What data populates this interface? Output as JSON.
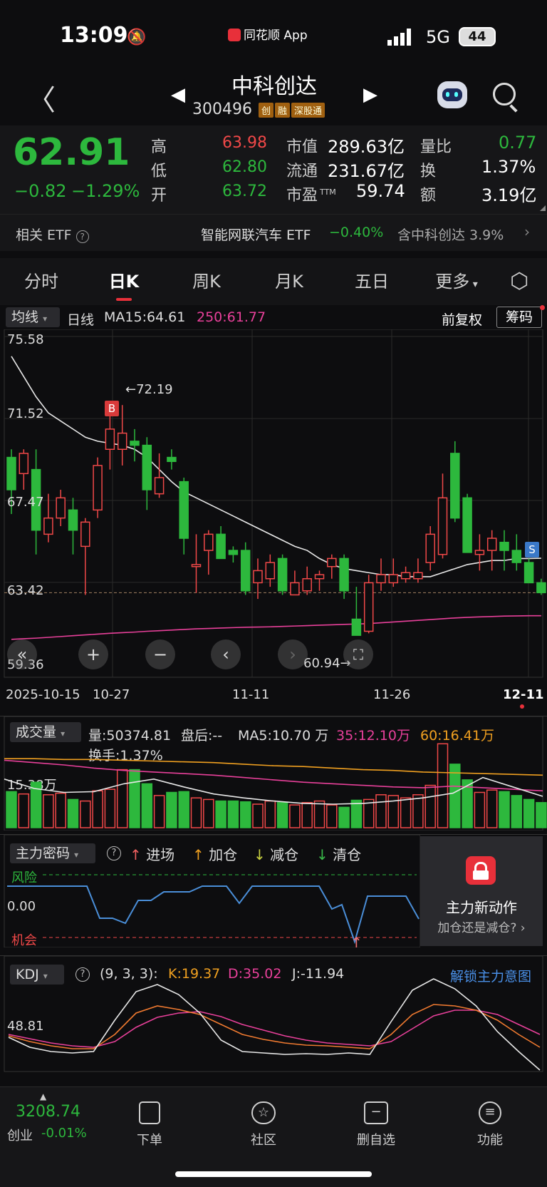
{
  "status_bar": {
    "time": "13:09",
    "app_name": "同花顺 App",
    "network": "5G",
    "battery": "44"
  },
  "header": {
    "name": "中科创达",
    "code": "300496",
    "tags": [
      "创",
      "融",
      "深股通"
    ]
  },
  "quote": {
    "price": "62.91",
    "change": "−0.82",
    "change_pct": "−1.29%",
    "stats": [
      {
        "label": "高",
        "value": "63.98",
        "color": "#f04848"
      },
      {
        "label": "低",
        "value": "62.80",
        "color": "#2db83d"
      },
      {
        "label": "开",
        "value": "63.72",
        "color": "#2db83d"
      },
      {
        "label": "市值",
        "value": "289.63亿"
      },
      {
        "label": "流通",
        "value": "231.67亿"
      },
      {
        "label": "市盈",
        "sup": "TTM",
        "value": "59.74"
      },
      {
        "label": "量比",
        "value": "0.77",
        "color": "#2db83d"
      },
      {
        "label": "换",
        "value": "1.37%"
      },
      {
        "label": "额",
        "value": "3.19亿"
      }
    ]
  },
  "etf": {
    "label": "相关 ETF",
    "name": "智能网联汽车 ETF",
    "change": "−0.40%",
    "contain": "含中科创达 3.9%"
  },
  "tabs": [
    "分时",
    "日K",
    "周K",
    "月K",
    "五日",
    "更多"
  ],
  "kline": {
    "ma_selector": "均线",
    "period": "日线",
    "ma15": "MA15:64.61",
    "ma250": "250:61.77",
    "adjust": "前复权",
    "chip_button": "筹码",
    "y_labels": [
      "75.58",
      "71.52",
      "67.47",
      "63.42",
      "59.36"
    ],
    "high_marker": "←72.19",
    "low_marker": "60.94→",
    "buy_mark": "B",
    "sell_mark": "S",
    "dates": [
      "2025-10-15",
      "10-27",
      "11-11",
      "11-26",
      "12-11"
    ]
  },
  "volume": {
    "selector": "成交量",
    "vol": "量:50374.81",
    "after": "盘后:--",
    "ma5": "MA5:10.70 万",
    "ma35": "35:12.10万",
    "ma60": "60:16.41万",
    "turnover": "换手:1.37%",
    "y_label": "15.38万"
  },
  "capital": {
    "selector": "主力密码",
    "legend": [
      "进场",
      "加仓",
      "减仓",
      "清仓"
    ],
    "risk": "风险",
    "chance": "机会",
    "zero": "0.00",
    "promo_title": "主力新动作",
    "promo_sub": "加仓还是减仓?"
  },
  "kdj": {
    "selector": "KDJ",
    "params": "(9, 3, 3):",
    "k": "K:19.37",
    "d": "D:35.02",
    "j": "J:-11.94",
    "unlock": "解锁主力意图",
    "y_label": "48.81"
  },
  "bottom_nav": {
    "index_value": "3208.74",
    "index_name": "创业",
    "index_change": "-0.01%",
    "items": [
      "下单",
      "社区",
      "删自选",
      "功能"
    ]
  },
  "chart_data": {
    "type": "candlestick",
    "x_ticks": [
      "2025-10-15",
      "10-27",
      "11-11",
      "11-26",
      "12-11"
    ],
    "ylim": [
      59.36,
      75.58
    ],
    "candles": [
      [
        69.6,
        70.0,
        66.8,
        68.0
      ],
      [
        68.8,
        70.0,
        68.0,
        69.8
      ],
      [
        69.0,
        70.0,
        64.8,
        66.0
      ],
      [
        65.8,
        67.8,
        65.4,
        66.6
      ],
      [
        66.6,
        68.0,
        66.2,
        67.6
      ],
      [
        67.0,
        67.6,
        64.8,
        66.0
      ],
      [
        65.2,
        66.6,
        62.8,
        66.4
      ],
      [
        67.0,
        69.6,
        66.6,
        69.2
      ],
      [
        70.0,
        72.4,
        69.0,
        71.0
      ],
      [
        70.0,
        72.19,
        69.2,
        70.8
      ],
      [
        70.4,
        71.0,
        69.4,
        70.2
      ],
      [
        70.2,
        70.6,
        67.0,
        68.0
      ],
      [
        67.8,
        69.8,
        67.6,
        68.6
      ],
      [
        69.6,
        70.0,
        69.0,
        69.4
      ],
      [
        68.4,
        68.6,
        64.8,
        65.6
      ],
      [
        64.2,
        65.8,
        62.9,
        64.3
      ],
      [
        65.0,
        66.0,
        63.8,
        65.8
      ],
      [
        65.8,
        66.2,
        64.8,
        64.6
      ],
      [
        65.0,
        65.2,
        64.4,
        64.8
      ],
      [
        65.0,
        65.4,
        62.8,
        63.0
      ],
      [
        63.4,
        64.6,
        62.6,
        64.0
      ],
      [
        63.6,
        64.8,
        63.2,
        64.4
      ],
      [
        64.6,
        64.8,
        62.8,
        63.0
      ],
      [
        62.8,
        64.0,
        62.8,
        63.4
      ],
      [
        63.0,
        64.2,
        62.8,
        63.6
      ],
      [
        63.6,
        64.0,
        63.0,
        63.8
      ],
      [
        64.2,
        64.8,
        63.6,
        64.6
      ],
      [
        64.6,
        64.8,
        62.6,
        63.0
      ],
      [
        61.6,
        63.2,
        60.94,
        60.8
      ],
      [
        61.0,
        63.8,
        60.9,
        63.4
      ],
      [
        63.4,
        64.6,
        63.0,
        63.8
      ],
      [
        63.4,
        64.6,
        63.2,
        63.8
      ],
      [
        63.6,
        64.2,
        63.4,
        63.9
      ],
      [
        63.6,
        64.6,
        63.4,
        63.9
      ],
      [
        64.4,
        66.2,
        64.0,
        65.8
      ],
      [
        64.8,
        68.8,
        64.6,
        67.6
      ],
      [
        69.8,
        70.4,
        66.4,
        66.6
      ],
      [
        67.6,
        67.8,
        64.9,
        64.9
      ],
      [
        64.8,
        65.8,
        64.0,
        65.0
      ],
      [
        65.0,
        66.0,
        64.0,
        65.6
      ],
      [
        65.4,
        66.0,
        64.0,
        65.0
      ],
      [
        65.0,
        65.8,
        64.0,
        64.4
      ],
      [
        64.4,
        64.6,
        63.4,
        63.4
      ],
      [
        63.4,
        63.6,
        62.8,
        62.91
      ]
    ],
    "ma15_line": [
      74.6,
      73.6,
      72.6,
      71.8,
      71.4,
      71.0,
      70.6,
      70.4,
      70.3,
      70.2,
      70.0,
      69.6,
      69.0,
      68.4,
      67.9,
      67.6,
      67.3,
      67.0,
      66.7,
      66.4,
      66.1,
      65.8,
      65.5,
      65.2,
      65.0,
      64.6,
      64.3,
      64.1,
      64.0,
      63.9,
      63.8,
      63.8,
      63.7,
      63.7,
      63.7,
      63.9,
      64.1,
      64.3,
      64.4,
      64.5,
      64.5,
      64.6,
      64.6,
      64.61
    ],
    "ma250_line": [
      60.6,
      60.63,
      60.66,
      60.7,
      60.74,
      60.78,
      60.82,
      60.86,
      60.9,
      60.93,
      60.96,
      61.0,
      61.03,
      61.06,
      61.09,
      61.12,
      61.14,
      61.16,
      61.18,
      61.2,
      61.21,
      61.22,
      61.24,
      61.26,
      61.28,
      61.3,
      61.32,
      61.34,
      61.36,
      61.38,
      61.42,
      61.46,
      61.5,
      61.54,
      61.58,
      61.62,
      61.66,
      61.69,
      61.71,
      61.73,
      61.75,
      61.76,
      61.77,
      61.77
    ]
  }
}
